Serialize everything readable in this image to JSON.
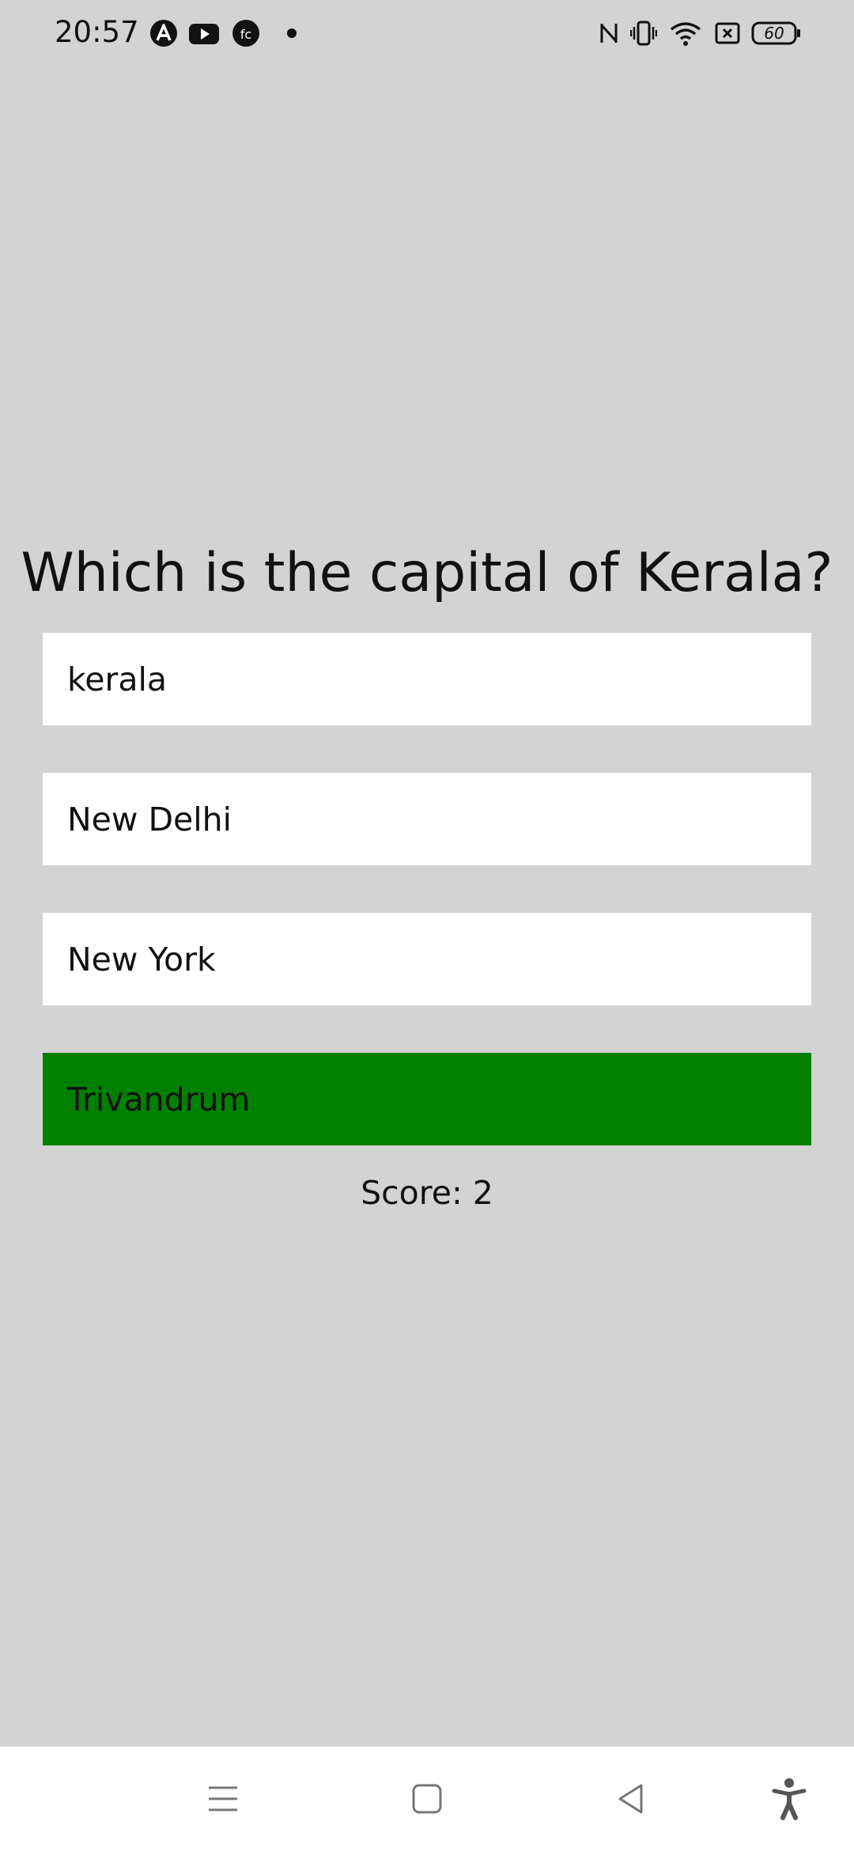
{
  "status_bar": {
    "time": "20:57",
    "battery_level": "60",
    "left_icons": [
      "app-a-icon",
      "youtube-icon",
      "fc-app-icon",
      "notification-dot-icon"
    ],
    "right_icons": [
      "nfc-icon",
      "vibrate-icon",
      "wifi-icon",
      "sim-off-icon",
      "battery-icon"
    ]
  },
  "quiz": {
    "question": "Which is the capital of Kerala?",
    "options": [
      {
        "label": "kerala",
        "state": "default"
      },
      {
        "label": "New Delhi",
        "state": "default"
      },
      {
        "label": "New York",
        "state": "default"
      },
      {
        "label": "Trivandrum",
        "state": "correct"
      }
    ],
    "score_text": "Score: 2"
  },
  "colors": {
    "background": "#d3d3d3",
    "option_default": "#ffffff",
    "option_correct": "#008000"
  },
  "nav_bar": {
    "buttons": [
      "menu-icon",
      "home-icon",
      "back-icon",
      "accessibility-icon"
    ]
  }
}
